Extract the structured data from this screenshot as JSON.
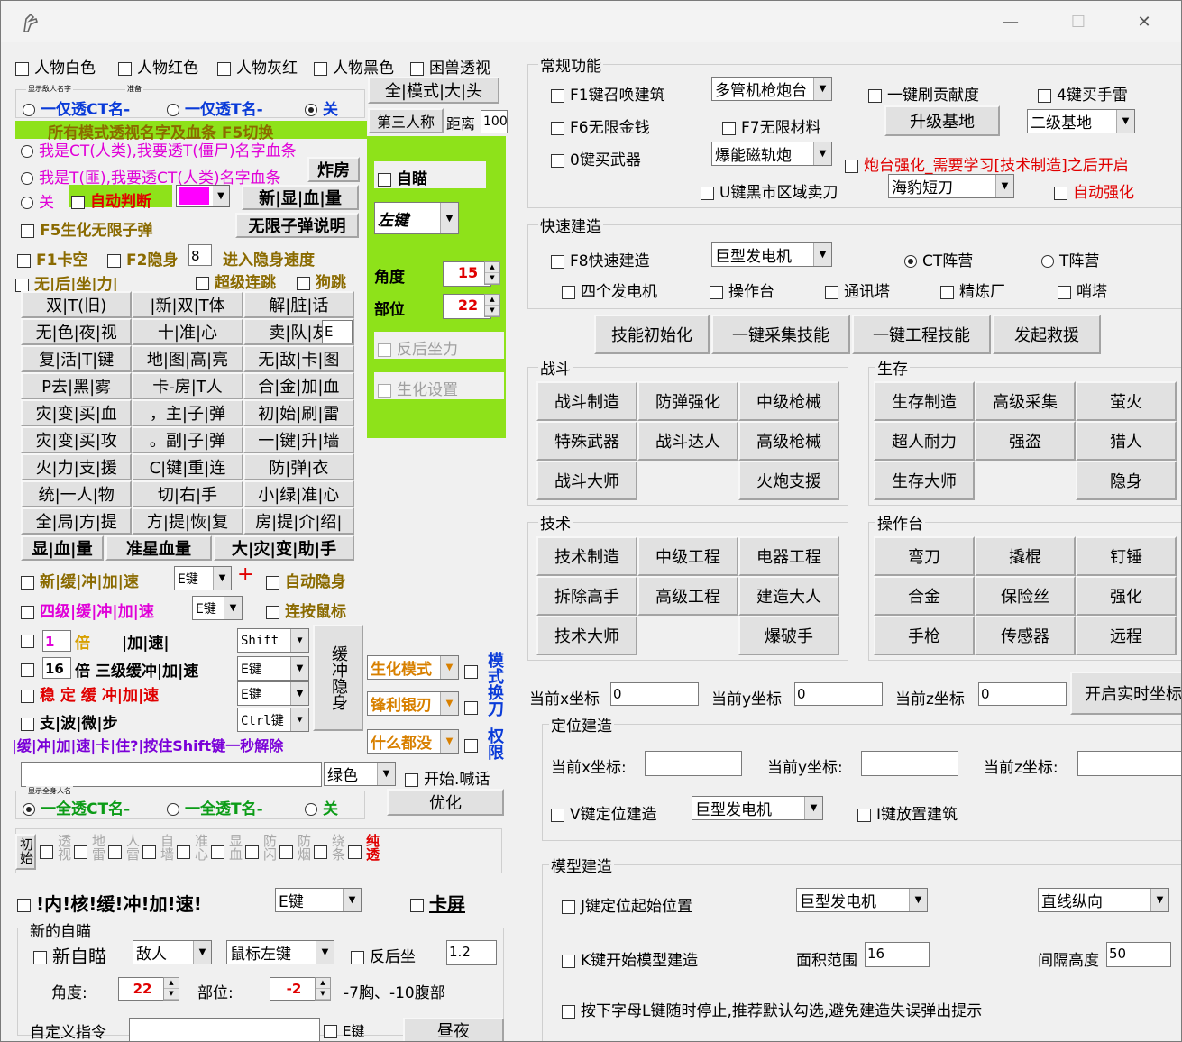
{
  "window": {
    "title_hint": "",
    "min": "—",
    "max": "☐",
    "close": "✕"
  },
  "left": {
    "row1": [
      "人物白色",
      "人物红色",
      "人物灰红",
      "人物黑色",
      "困兽透视"
    ],
    "tiny1": "显示敌人名字",
    "tiny2": "准备",
    "radio1": [
      "一仅透CT名-",
      "一仅透T名-",
      "关"
    ],
    "btn_all_mode": "全|模式|大|头",
    "green_header": "所有模式透视名字及血条  F5切换",
    "btn_third": "第三人称",
    "lbl_dist": "距离",
    "val_dist": "100",
    "radio2a": "我是CT(人类),我要透T(僵尸)名字血条",
    "radio2b": "我是T(匪),我要透CT(人类)名字血条",
    "btn_zha": "炸房",
    "radio2c": "关",
    "auto_judge": "自动判断",
    "btn_new_blood": "新|显|血|量",
    "aim_label": "自瞄",
    "aim_key": "左键",
    "lbl_angle": "角度",
    "val_angle": "15",
    "lbl_part": "部位",
    "val_part": "22",
    "recoil": "反后坐力",
    "bio_set": "生化设置",
    "f5_infinite": "F5生化无限子弹",
    "btn_infinite_desc": "无限子弹说明",
    "f1": "F1卡空",
    "f2": "F2隐身",
    "val_stealth": "8",
    "stealth_speed": "进入隐身速度",
    "no_recoil": "无|后|坐|力|",
    "super_combo": "超级连跳",
    "dog_jump": "狗跳",
    "grid": [
      "双|T(旧)",
      "|新|双|T体",
      "解|脏|话",
      "无|色|夜|视",
      "十|准|心",
      "卖|队|友",
      "复|活|T|键",
      "地|图|高|亮",
      "无|敌|卡|图",
      "P去|黑|雾",
      "卡-房|T人",
      "合|金|加|血",
      "灾|变|买|血",
      "，主|子|弹",
      "初|始|刷|雷",
      "灾|变|买|攻",
      "。副|子|弹",
      "一|键|升|墙",
      "火|力|支|援",
      "C|键|重|连",
      "防|弹|衣",
      "统|一人|物",
      "切|右|手",
      "小|绿|准|心",
      "全|局|方|提",
      "方|提|恢|复",
      "房|提|介|绍|"
    ],
    "sell_key": "E",
    "btn_show_blood": "显|血|量",
    "btn_star_blood": "准星血量",
    "btn_disaster": "大|灾|变|助|手",
    "new_buffer": "新|缓|冲|加|速",
    "key_e": "E键",
    "plus": "+",
    "auto_stealth": "自动隐身",
    "lvl4_buffer": "四级|缓|冲|加|速",
    "key_e2": "E键",
    "auto_click": "连按鼠标",
    "mult_val": "1",
    "mult": "倍",
    "accel": "|加|速|",
    "key_shift": "Shift",
    "val16": "16",
    "lvl3": "倍  三级缓冲|加|速",
    "key_e3": "E键",
    "stable": "稳 定 缓 冲|加|速",
    "key_e4": "E键",
    "wave": "支|波|微|步",
    "key_ctrl": "Ctrl键",
    "buffer_vert": "缓冲隐身",
    "bio_mode": "生化模式",
    "mode_vert": "模式换刀",
    "weapon": "锋利银刃",
    "perm": "权限",
    "anything": "什么都没",
    "stuck_tip": "|缓|冲|加|速|卡|住?|按住Shift键一秒解除",
    "color_sel": "绿色",
    "start_shout": "开始.喊话",
    "tiny3": "显示全身人名",
    "radio3": [
      "一全透CT名-",
      "一全透T名-",
      "关"
    ],
    "btn_optimize": "优化",
    "init_row": [
      "初始",
      "透视",
      "地雷",
      "人雷",
      "自墙",
      "准心",
      "显血",
      "防闪",
      "防烟",
      "绕条",
      "纯透"
    ],
    "inner_core": "!内!核!缓!冲!加!速!",
    "key_e5": "E键",
    "stuck_screen": "卡屏",
    "new_aim_group": "新的自瞄",
    "new_aim": "新自瞄",
    "target": "敌人",
    "mouse_key": "鼠标左键",
    "recoil2": "反后坐",
    "val_12": "1.2",
    "lbl_angle2": "角度:",
    "val_angle2": "22",
    "lbl_part2": "部位:",
    "val_part2": "-2",
    "part_hint": "-7胸、-10腹部",
    "custom_cmd": "自定义指令",
    "key_e6": "E键",
    "btn_night": "昼夜"
  },
  "right": {
    "general_group": "常规功能",
    "f1_summon": "F1键召唤建筑",
    "combo_turret": "多管机枪炮台",
    "one_key_contrib": "一键刷贡献度",
    "buy_grenade": "4键买手雷",
    "f6_money": "F6无限金钱",
    "f7_material": "F7无限材料",
    "btn_upgrade": "升级基地",
    "combo_base": "二级基地",
    "buy_weapon": "0键买武器",
    "combo_gun": "爆能磁轨炮",
    "turret_hint": "炮台强化_需要学习[技术制造]之后开启",
    "black_market": "U键黑市区域卖刀",
    "combo_knife": "海豹短刀",
    "auto_enhance": "自动强化",
    "quick_group": "快速建造",
    "f8_quick": "F8快速建造",
    "combo_gen": "巨型发电机",
    "ct_camp": "CT阵营",
    "t_camp": "T阵营",
    "quick_row": [
      "四个发电机",
      "操作台",
      "通讯塔",
      "精炼厂",
      "哨塔"
    ],
    "btn_skill_init": "技能初始化",
    "btn_gather": "一键采集技能",
    "btn_engineer": "一键工程技能",
    "btn_rescue": "发起救援",
    "combat_group": "战斗",
    "combat": [
      "战斗制造",
      "防弹强化",
      "中级枪械",
      "特殊武器",
      "战斗达人",
      "高级枪械",
      "战斗大师",
      "",
      "火炮支援"
    ],
    "survive_group": "生存",
    "survive": [
      "生存制造",
      "高级采集",
      "萤火",
      "超人耐力",
      "强盗",
      "猎人",
      "生存大师",
      "",
      "隐身"
    ],
    "tech_group": "技术",
    "tech": [
      "技术制造",
      "中级工程",
      "电器工程",
      "拆除高手",
      "高级工程",
      "建造大人",
      "技术大师",
      "",
      "爆破手"
    ],
    "console_group": "操作台",
    "console": [
      "弯刀",
      "撬棍",
      "钉锤",
      "合金",
      "保险丝",
      "强化",
      "手枪",
      "传感器",
      "远程"
    ],
    "cur_x": "当前x坐标",
    "cur_y": "当前y坐标",
    "cur_z": "当前z坐标",
    "val_x": "0",
    "val_y": "0",
    "val_z": "0",
    "btn_realtime": "开启实时坐标",
    "locate_group": "定位建造",
    "cur_x2": "当前x坐标:",
    "cur_y2": "当前y坐标:",
    "cur_z2": "当前z坐标:",
    "v_locate": "V键定位建造",
    "combo_gen2": "巨型发电机",
    "i_place": "I键放置建筑",
    "model_group": "模型建造",
    "j_locate": "J键定位起始位置",
    "combo_gen3": "巨型发电机",
    "combo_dir": "直线纵向",
    "k_model": "K键开始模型建造",
    "area": "面积范围",
    "val_area": "16",
    "gap": "间隔高度",
    "val_gap": "50",
    "l_stop": "按下字母L键随时停止,推荐默认勾选,避免建造失误弹出提示"
  }
}
